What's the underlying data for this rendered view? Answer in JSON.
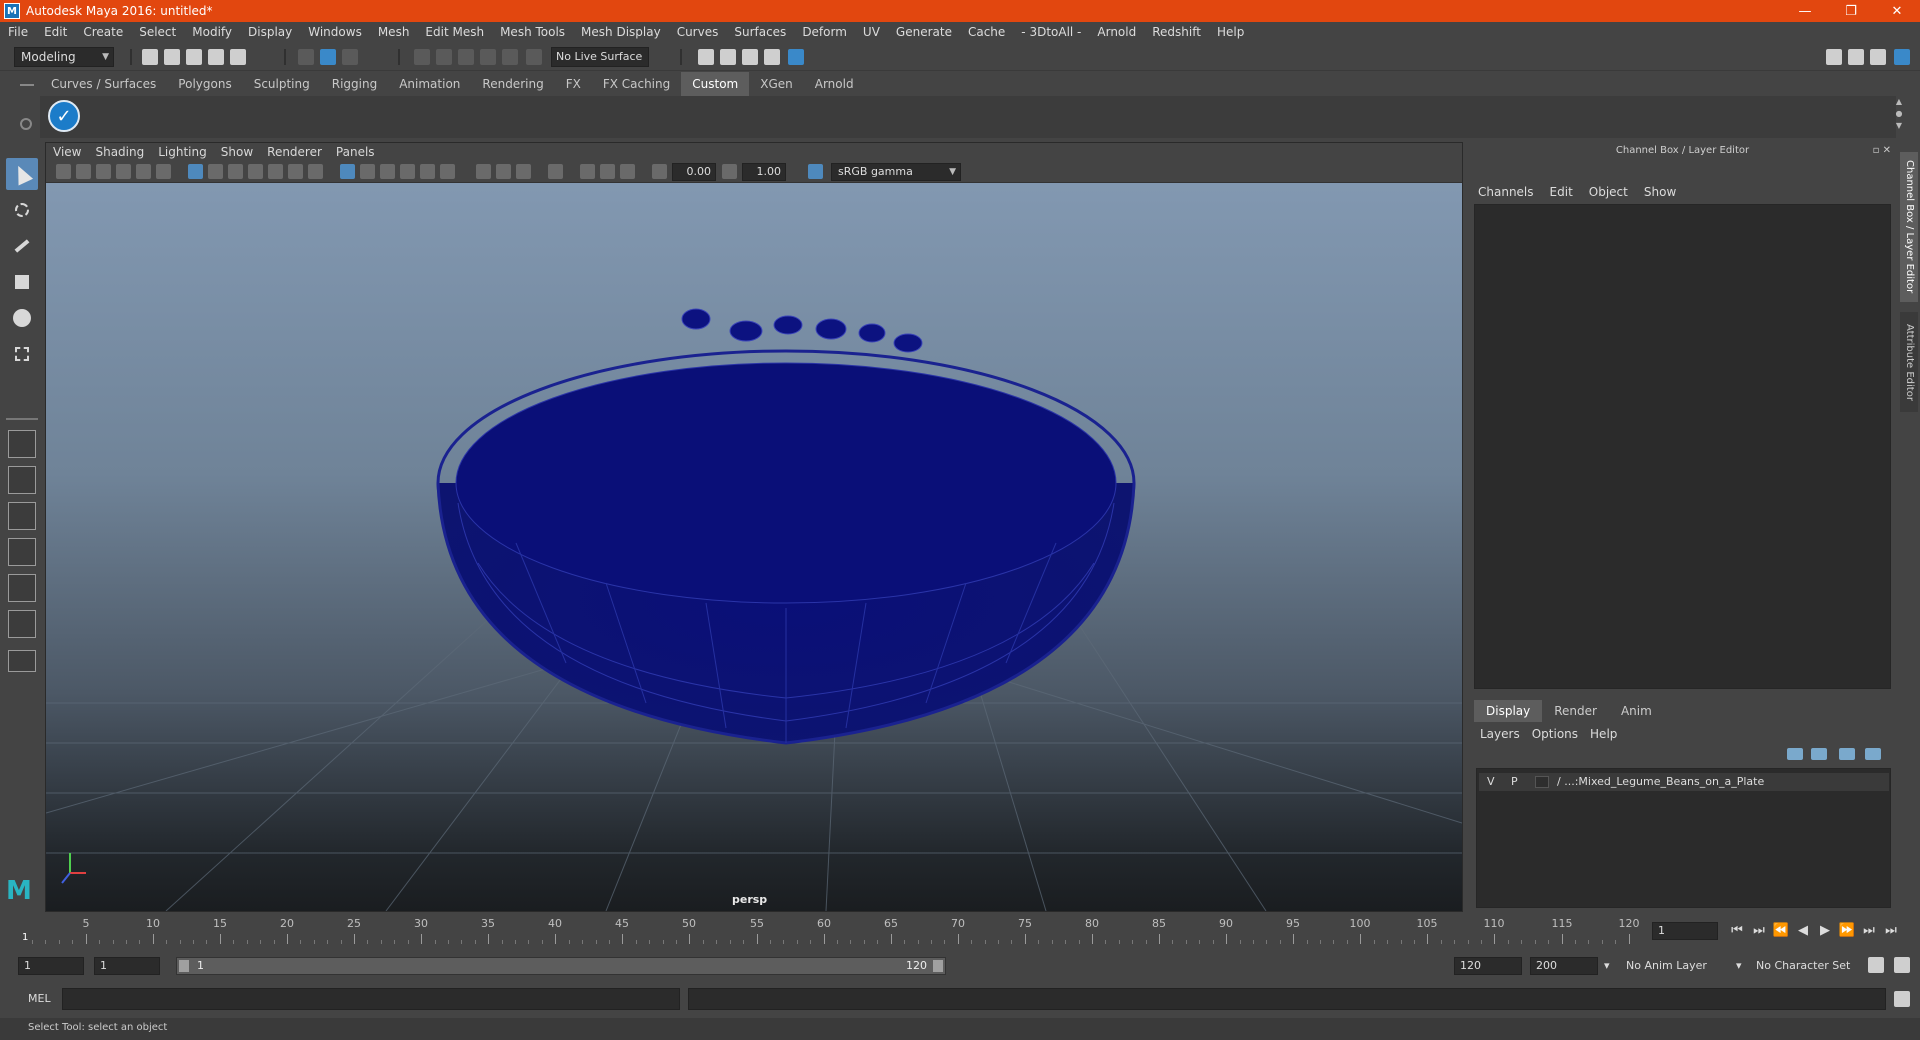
{
  "window": {
    "title": "Autodesk Maya 2016: untitled*",
    "logo_glyph": "M"
  },
  "window_controls": {
    "minimize": "—",
    "restore": "❐",
    "close": "✕"
  },
  "menus": [
    "File",
    "Edit",
    "Create",
    "Select",
    "Modify",
    "Display",
    "Windows",
    "Mesh",
    "Edit Mesh",
    "Mesh Tools",
    "Mesh Display",
    "Curves",
    "Surfaces",
    "Deform",
    "UV",
    "Generate",
    "Cache",
    "- 3DtoAll -",
    "Arnold",
    "Redshift",
    "Help"
  ],
  "statusline": {
    "mode": "Modeling",
    "live_surface": "No Live Surface"
  },
  "shelf": {
    "tabs": [
      "Curves / Surfaces",
      "Polygons",
      "Sculpting",
      "Rigging",
      "Animation",
      "Rendering",
      "FX",
      "FX Caching",
      "Custom",
      "XGen",
      "Arnold"
    ],
    "active_tab": "Custom",
    "check_glyph": "✓"
  },
  "viewport": {
    "menus": [
      "View",
      "Shading",
      "Lighting",
      "Show",
      "Renderer",
      "Panels"
    ],
    "exposure": "0.00",
    "gamma_value": "1.00",
    "color_space": "sRGB gamma",
    "camera": "persp"
  },
  "channel_box": {
    "title": "Channel Box / Layer Editor",
    "title_buttons": "▫ ✕",
    "menus": [
      "Channels",
      "Edit",
      "Object",
      "Show"
    ]
  },
  "layer_editor": {
    "tabs": [
      "Display",
      "Render",
      "Anim"
    ],
    "active_tab": "Display",
    "menus": [
      "Layers",
      "Options",
      "Help"
    ],
    "layers": [
      {
        "v": "V",
        "p": "P",
        "name": "/ ...:Mixed_Legume_Beans_on_a_Plate"
      }
    ]
  },
  "side_tabs": [
    "Channel Box / Layer Editor",
    "Attribute Editor"
  ],
  "timeline": {
    "labels": [
      "5",
      "10",
      "15",
      "20",
      "25",
      "30",
      "35",
      "40",
      "45",
      "50",
      "55",
      "60",
      "65",
      "70",
      "75",
      "80",
      "85",
      "90",
      "95",
      "100",
      "105",
      "110",
      "115",
      "120"
    ],
    "current_frame_marker": "1",
    "current_frame": "1",
    "playback_glyphs": [
      "⏮",
      "⏭",
      "⏪",
      "◀",
      "▶",
      "⏩",
      "⏭",
      "⏭"
    ]
  },
  "range": {
    "start": "1",
    "playback_start": "1",
    "bar_start": "1",
    "bar_end": "120",
    "playback_end": "120",
    "end": "200",
    "anim_layer": "No Anim Layer",
    "character_set": "No Character Set"
  },
  "command_line": {
    "label": "MEL"
  },
  "help_line": {
    "text": "Select Tool: select an object"
  },
  "colors": {
    "title_bar": "#e2470f",
    "wireframe": "#0b0f6e",
    "active_tool": "#5a89b8",
    "accent_blue": "#1c7cc9"
  }
}
